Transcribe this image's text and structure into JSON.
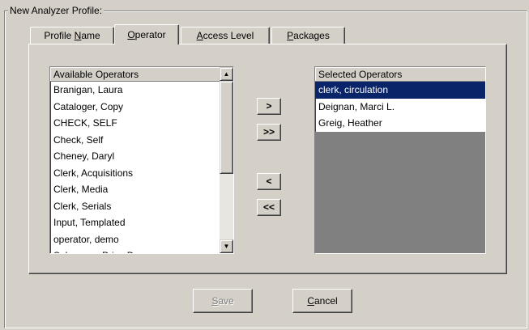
{
  "group": {
    "title": "New Analyzer Profile:"
  },
  "tabs": [
    {
      "pre": "Profile ",
      "mn": "N",
      "post": "ame"
    },
    {
      "pre": "",
      "mn": "O",
      "post": "perator"
    },
    {
      "pre": "",
      "mn": "A",
      "post": "ccess Level"
    },
    {
      "pre": "",
      "mn": "P",
      "post": "ackages"
    }
  ],
  "available": {
    "header": "Available Operators",
    "items": [
      "Branigan, Laura",
      "Cataloger, Copy",
      "CHECK, SELF",
      "Check, Self",
      "Cheney, Daryl",
      "Clerk, Acquisitions",
      "Clerk, Media",
      "Clerk, Serials",
      "Input, Templated",
      "operator, demo",
      "Salesman, Price D."
    ]
  },
  "selected": {
    "header": "Selected Operators",
    "items": [
      "clerk, circulation",
      "Deignan, Marci L.",
      "Greig, Heather"
    ]
  },
  "move_buttons": {
    "add": ">",
    "add_all": ">>",
    "remove": "<",
    "remove_all": "<<"
  },
  "buttons": {
    "save": {
      "mn": "S",
      "rest": "ave"
    },
    "cancel": {
      "mn": "C",
      "rest": "ancel"
    }
  },
  "colors": {
    "selection": "#0a246a",
    "face": "#d4d0c8"
  }
}
